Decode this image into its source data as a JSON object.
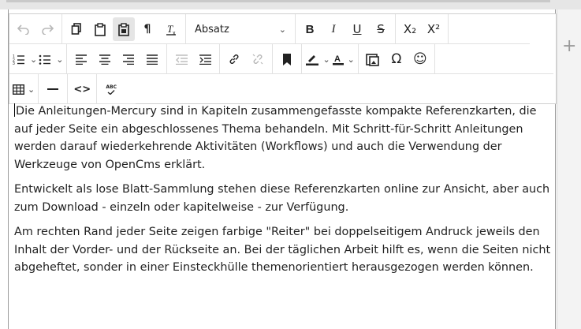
{
  "toolbar": {
    "row1": {
      "undo_icon": "undo-icon",
      "redo_icon": "redo-icon",
      "format_select_value": "Absatz",
      "bold_label": "B",
      "italic_label": "I",
      "underline_label": "U",
      "strike_label": "S",
      "subscript_label": "X₂",
      "superscript_label": "X²",
      "paragraph_label": "¶"
    },
    "row2": {
      "special_char_label": "Ω",
      "emoji_label": "☺"
    },
    "row3": {
      "code_label": "<>",
      "spellcheck_label": "ABC"
    }
  },
  "content": {
    "paragraphs": [
      "Die Anleitungen-Mercury sind in Kapiteln zusammengefasste kompakte Referenzkarten, die auf jeder Seite ein abgeschlossenes Thema behandeln. Mit Schritt-für-Schritt Anlei­tungen werden darauf wiederkehrende Aktivitäten (Workflows) und auch die Verwen­dung der Werkzeuge von OpenCms erklärt.",
      "Entwickelt als lose Blatt-Sammlung stehen diese Referenzkarten online zur Ansicht, aber auch zum Download - einzeln oder kapitelweise - zur Verfügung.",
      "Am rechten Rand jeder Seite zeigen farbige \"Reiter\" bei doppelseitigem Andruck jeweils den Inhalt der Vorder- und der Rückseite an. Bei der täglichen Arbeit hilft es, wenn die Seiten nicht abgeheftet, sonder in einer Einsteckhülle themenorientiert herausgezogen werden können."
    ]
  },
  "side": {
    "add_label": "+"
  }
}
